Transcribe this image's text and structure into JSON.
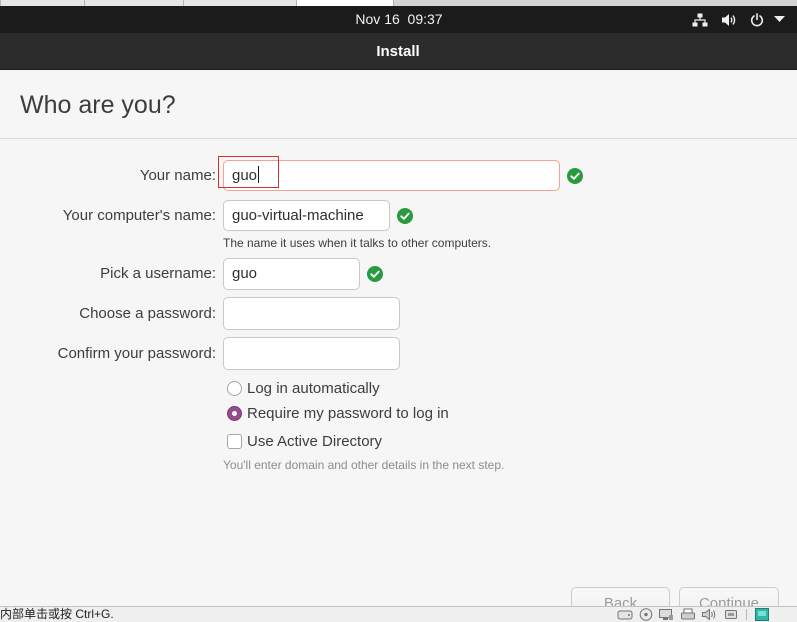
{
  "topbar": {
    "clock": "Nov 16  09:37",
    "icons": [
      "network-icon",
      "volume-icon",
      "power-icon",
      "menu-arrow-icon"
    ]
  },
  "window": {
    "title": "Install"
  },
  "page": {
    "heading": "Who are you?"
  },
  "form": {
    "name": {
      "label": "Your name:",
      "value": "guo",
      "valid": true,
      "focused": true
    },
    "computer_name": {
      "label": "Your computer's name:",
      "value": "guo-virtual-machine",
      "valid": true,
      "hint": "The name it uses when it talks to other computers."
    },
    "username": {
      "label": "Pick a username:",
      "value": "guo",
      "valid": true
    },
    "password": {
      "label": "Choose a password:",
      "value": ""
    },
    "confirm_password": {
      "label": "Confirm your password:",
      "value": ""
    },
    "login_options": [
      {
        "label": "Log in automatically",
        "selected": false
      },
      {
        "label": "Require my password to log in",
        "selected": true
      }
    ],
    "active_directory": {
      "label": "Use Active Directory",
      "checked": false,
      "hint": "You'll enter domain and other details in the next step."
    }
  },
  "buttons": {
    "back": "Back",
    "continue": "Continue"
  },
  "statusbar": {
    "message": "内部单击或按 Ctrl+G.",
    "icons": [
      "hard-disk-icon",
      "cd-rom-icon",
      "network-adapter-icon",
      "printer-icon",
      "sound-icon",
      "usb-device-icon",
      "vm-display-icon"
    ]
  },
  "colors": {
    "accent_purple": "#924d8b",
    "valid_green": "#2a9a3f",
    "focus_border": "#eea491",
    "annotation_red": "#d03030",
    "topbar_bg": "#1b1b1b",
    "headerbar_bg": "#2c2c2c"
  }
}
